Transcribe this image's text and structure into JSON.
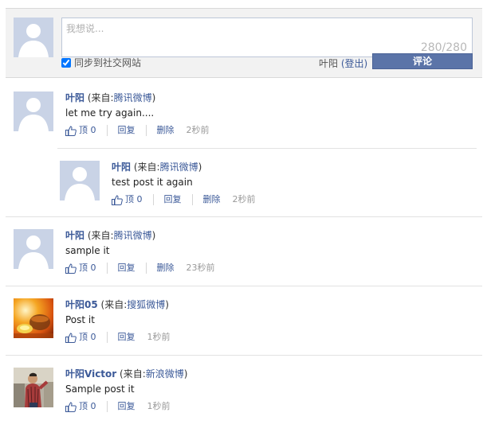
{
  "composer": {
    "placeholder": "我想说...",
    "counter": "280/280",
    "sync_label": "同步到社交网站",
    "sync_checked": true,
    "username": "叶阳",
    "logout_label": "(登出)",
    "submit_label": "评论"
  },
  "labels": {
    "from_prefix": "(来自:",
    "from_suffix": ")",
    "like": "顶 0",
    "reply": "回复",
    "delete": "删除"
  },
  "comments": [
    {
      "user": "叶阳",
      "source": "腾讯微博",
      "text": "let me try again....",
      "time": "2秒前",
      "avatar": "placeholder-avatar"
    },
    {
      "user": "叶阳",
      "source": "腾讯微博",
      "text": "test post it again",
      "time": "2秒前",
      "avatar": "placeholder-avatar",
      "is_reply": true
    },
    {
      "user": "叶阳",
      "source": "腾讯微博",
      "text": "sample it",
      "time": "23秒前",
      "avatar": "placeholder-avatar"
    },
    {
      "user": "叶阳05",
      "source": "搜狐微博",
      "text": "Post it",
      "time": "1秒前",
      "avatar": "photo-tea-avatar"
    },
    {
      "user": "叶阳Victor",
      "source": "新浪微博",
      "text": "Sample post it",
      "time": "1秒前",
      "avatar": "photo-person-avatar"
    }
  ],
  "colors": {
    "link": "#3b5998",
    "submit_bg": "#5b74a8",
    "composer_bg": "#f2f2f2",
    "placeholder_avatar_bg": "#c9d3e6"
  }
}
